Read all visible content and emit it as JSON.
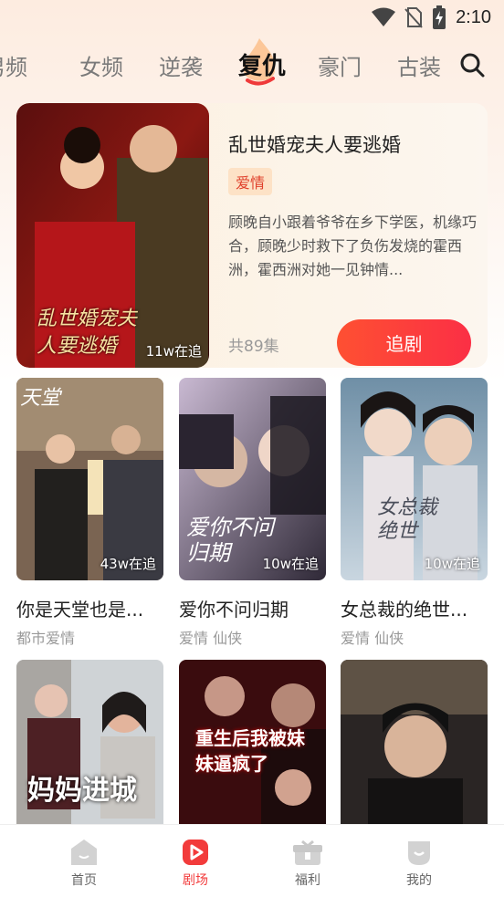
{
  "status_bar": {
    "time": "2:10"
  },
  "tabs": [
    {
      "label": "男频"
    },
    {
      "label": "女频"
    },
    {
      "label": "逆袭"
    },
    {
      "label": "复仇"
    },
    {
      "label": "豪门"
    },
    {
      "label": "古装"
    }
  ],
  "featured": {
    "title": "乱世婚宠夫人要逃婚",
    "tag": "爱情",
    "description": "顾晚自小跟着爷爷在乡下学医，机缘巧合，顾晚少时救下了负伤发烧的霍西洲，霍西洲对她一见钟情...",
    "episodes": "共89集",
    "follow_label": "追剧",
    "watch_count": "11w在追",
    "poster_text": "乱世婚宠夫人要逃婚"
  },
  "dramas": [
    {
      "title": "你是天堂也是...",
      "tags": "都市爱情",
      "watch_count": "43w在追",
      "poster_text": "天堂"
    },
    {
      "title": "爱你不问归期",
      "tags": "爱情 仙侠",
      "watch_count": "10w在追",
      "poster_text": "爱你不问归期"
    },
    {
      "title": "女总裁的绝世...",
      "tags": "爱情 仙侠",
      "watch_count": "10w在追",
      "poster_text": "女总裁绝世"
    },
    {
      "title": "",
      "tags": "",
      "watch_count": "",
      "poster_text": "妈妈进城"
    },
    {
      "title": "",
      "tags": "",
      "watch_count": "",
      "poster_text": "重生后我被妹妹逼疯了"
    },
    {
      "title": "",
      "tags": "",
      "watch_count": "",
      "poster_text": ""
    }
  ],
  "bottom_nav": [
    {
      "label": "首页",
      "icon": "home-icon"
    },
    {
      "label": "剧场",
      "icon": "theater-play-icon"
    },
    {
      "label": "福利",
      "icon": "gift-icon"
    },
    {
      "label": "我的",
      "icon": "profile-icon"
    }
  ],
  "colors": {
    "accent": "#f23b3b",
    "button_gradient_start": "#fe5032",
    "button_gradient_end": "#fb2f45",
    "tag_bg": "#fde2c6",
    "tag_text": "#e0402b"
  }
}
